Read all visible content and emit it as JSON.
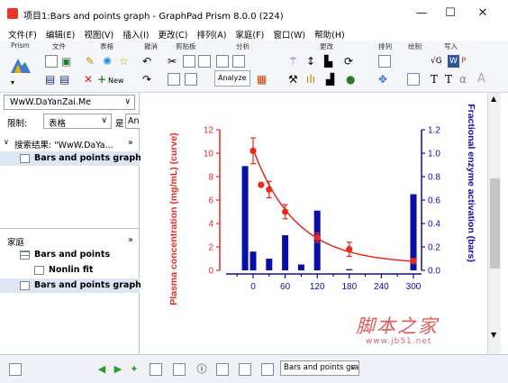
{
  "window": {
    "title": "项目1:Bars and points graph - GraphPad Prism 8.0.0 (224)",
    "minimize_glyph": "—",
    "maximize_glyph": "☐",
    "close_glyph": "✕"
  },
  "menu": [
    "文件(F)",
    "编辑(E)",
    "视图(V)",
    "插入(I)",
    "更改(C)",
    "排列(A)",
    "家庭(F)",
    "窗口(W)",
    "帮助(H)"
  ],
  "ribbon": {
    "groups": [
      "Prism",
      "文件",
      "表格",
      "撤消",
      "剪贴板",
      "分析",
      "更改",
      "排列",
      "绘制",
      "写入"
    ],
    "new_label": "New",
    "analyze_label": "Analyze"
  },
  "navigator": {
    "search_value": "WwW.DaYanZai.Me",
    "limit_label": "限制:",
    "limit_value": "表格",
    "is_label": "是",
    "is_value": "An",
    "search_result": "搜索结果: \"WwW.DaYa...",
    "result_item": "Bars and points graph",
    "family_label": "家庭",
    "family_items": [
      {
        "label": "Bars and points",
        "kind": "table"
      },
      {
        "label": "Nonlin fit",
        "kind": "results"
      },
      {
        "label": "Bars and points graph",
        "kind": "graph"
      }
    ]
  },
  "statusbar": {
    "sheet_select": "Bars and points gra"
  },
  "watermark": {
    "text": "脚本之家",
    "url": "www.jb51.net"
  },
  "colors": {
    "red": "#e8281e",
    "blue": "#0a0ea8"
  },
  "chart_data": {
    "type": "bar",
    "left_axis": {
      "label": "Plasma concentration (mg/mL) (curve)",
      "ticks": [
        "0",
        "2",
        "4",
        "6",
        "8",
        "10",
        "12"
      ],
      "ylim": [
        0,
        12
      ]
    },
    "right_axis": {
      "label": "Fractional enzyme activation (bars)",
      "ticks": [
        "0.0",
        "0.2",
        "0.4",
        "0.6",
        "0.8",
        "1.0",
        "1.2"
      ],
      "ylim": [
        0,
        1.2
      ]
    },
    "x_axis": {
      "ticks": [
        "0",
        "60",
        "120",
        "180",
        "240",
        "300"
      ],
      "xlim": [
        -30,
        300
      ]
    },
    "bars": {
      "x": [
        -15,
        0,
        30,
        60,
        90,
        120,
        180,
        300
      ],
      "values": [
        0.89,
        0.16,
        0.1,
        0.3,
        0.05,
        0.51,
        0.01,
        0.65
      ]
    },
    "points": {
      "x": [
        0,
        15,
        30,
        60,
        120,
        180,
        300
      ],
      "y": [
        10.2,
        7.3,
        6.9,
        5.0,
        2.8,
        1.8,
        0.8
      ],
      "err": [
        1.1,
        0,
        0.7,
        0.6,
        0.4,
        0.6,
        0.2
      ]
    }
  }
}
